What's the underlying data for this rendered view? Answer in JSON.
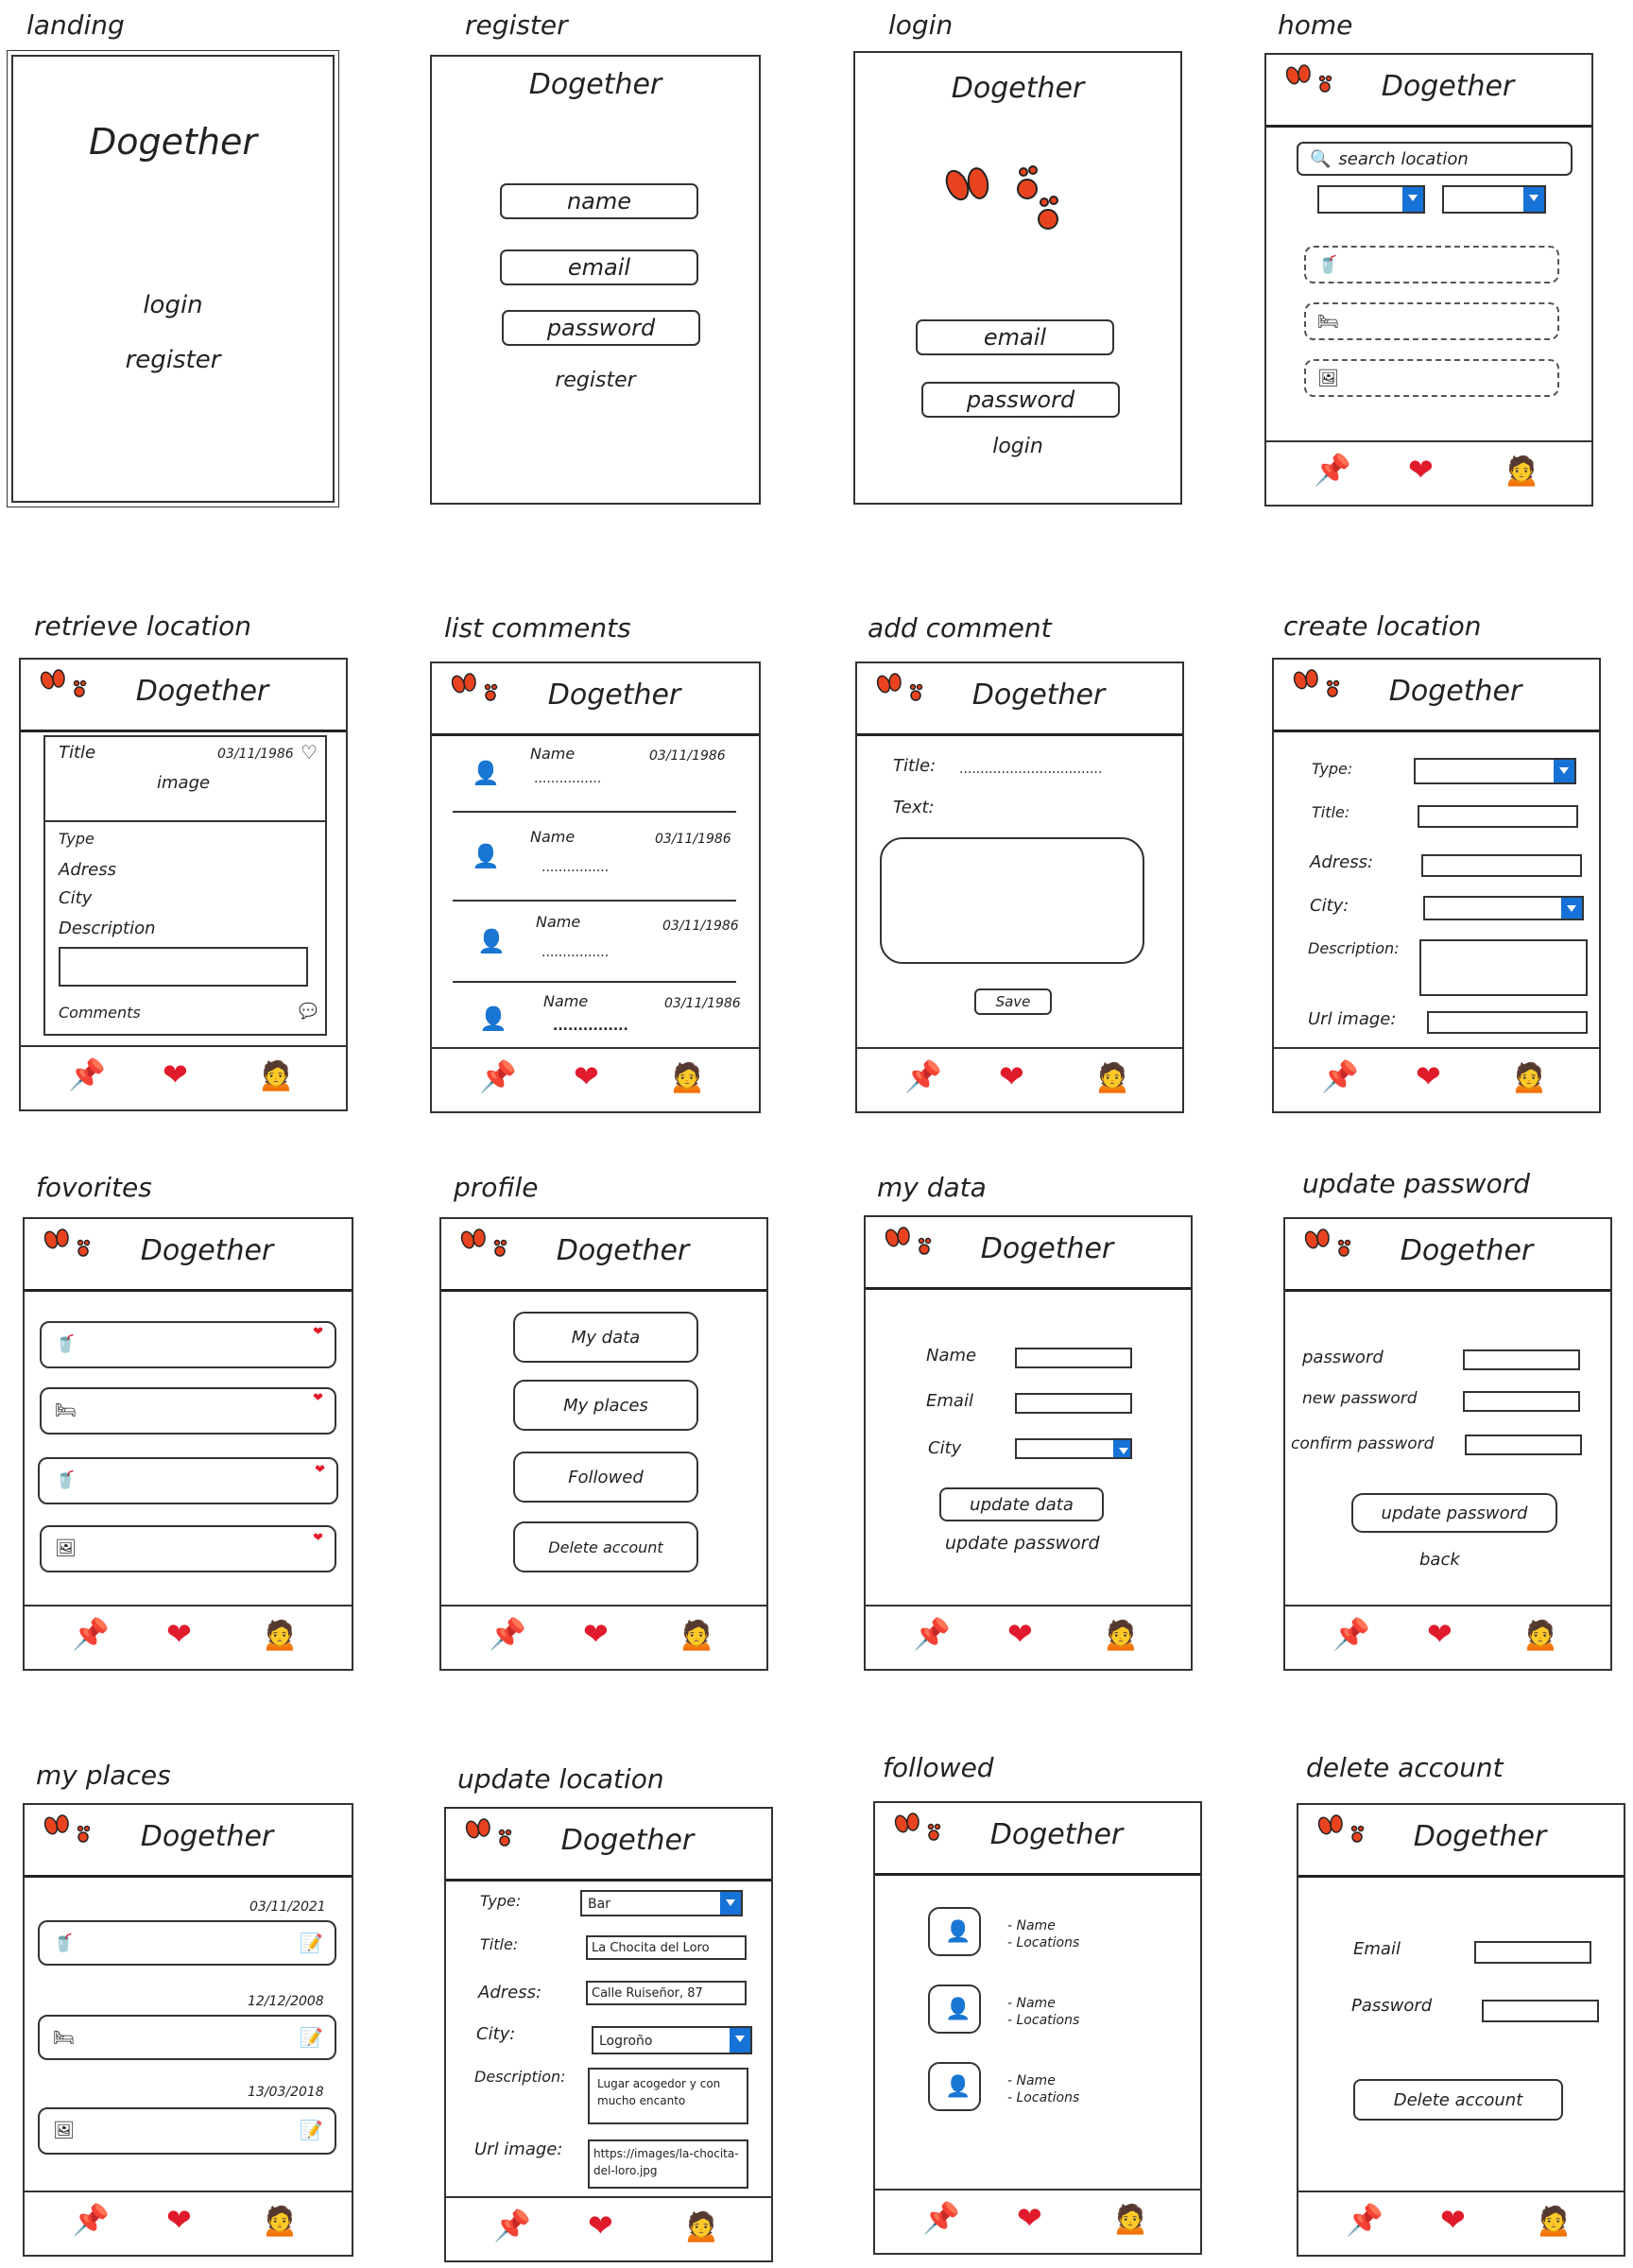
{
  "brand": "Dogether",
  "labels": {
    "landing": "landing",
    "register": "register",
    "login": "login",
    "home": "home",
    "retrieve": "retrieve location",
    "list_comments": "list comments",
    "add_comment": "add comment",
    "create_location": "create location",
    "favorites": "fovorites",
    "profile": "profile",
    "my_data": "my data",
    "update_password": "update password",
    "my_places": "my places",
    "update_location": "update location",
    "followed": "followed",
    "delete_account": "delete account"
  },
  "landing": {
    "title": "Dogether",
    "login": "login",
    "register": "register"
  },
  "register": {
    "title": "Dogether",
    "name": "name",
    "email": "email",
    "password": "password",
    "submit": "register"
  },
  "login": {
    "title": "Dogether",
    "email": "email",
    "password": "password",
    "submit": "login"
  },
  "home": {
    "search_placeholder": "search location"
  },
  "retrieve": {
    "title": "Title",
    "date": "03/11/1986",
    "image": "image",
    "type": "Type",
    "address": "Adress",
    "city": "City",
    "description": "Description",
    "comments": "Comments"
  },
  "list_comments": {
    "items": [
      {
        "name": "Name",
        "date": "03/11/1986",
        "text": "................"
      },
      {
        "name": "Name",
        "date": "03/11/1986",
        "text": "................"
      },
      {
        "name": "Name",
        "date": "03/11/1986",
        "text": "................"
      },
      {
        "name": "Name",
        "date": "03/11/1986",
        "text": "..............."
      }
    ]
  },
  "add_comment": {
    "title_label": "Title:",
    "title_dots": "..................................",
    "text_label": "Text:",
    "save": "Save"
  },
  "create_location": {
    "type": "Type:",
    "title": "Title:",
    "address": "Adress:",
    "city": "City:",
    "description": "Description:",
    "url": "Url image:"
  },
  "profile": {
    "my_data": "My data",
    "my_places": "My places",
    "followed": "Followed",
    "delete": "Delete account"
  },
  "my_data": {
    "name": "Name",
    "email": "Email",
    "city": "City",
    "update": "update data",
    "update_password": "update password"
  },
  "update_password": {
    "password": "password",
    "new_password": "new password",
    "confirm": "confirm password",
    "submit": "update password",
    "back": "back"
  },
  "my_places": {
    "dates": [
      "03/11/2021",
      "12/12/2008",
      "13/03/2018"
    ]
  },
  "update_location": {
    "type": "Type:",
    "title": "Title:",
    "address": "Adress:",
    "city": "City:",
    "description": "Description:",
    "url": "Url image:",
    "type_value": "Bar",
    "title_value": "La Chocita del Loro",
    "address_value": "Calle Ruiseñor, 87",
    "city_value": "Logroño",
    "description_value": "Lugar acogedor y con mucho encanto",
    "url_value": "https://images/la-chocita-del-loro.jpg"
  },
  "followed": {
    "name": "- Name",
    "locations": "- Locations"
  },
  "delete_account": {
    "email": "Email",
    "password": "Password",
    "submit": "Delete account"
  },
  "icons": {
    "paw": "paw-prints-icon",
    "pin": "pushpin-icon",
    "heart": "heart-icon",
    "user": "user-icon"
  },
  "colors": {
    "accent": "#e8431f",
    "heart": "#e01b2c",
    "select_arrow": "#1672d6"
  }
}
